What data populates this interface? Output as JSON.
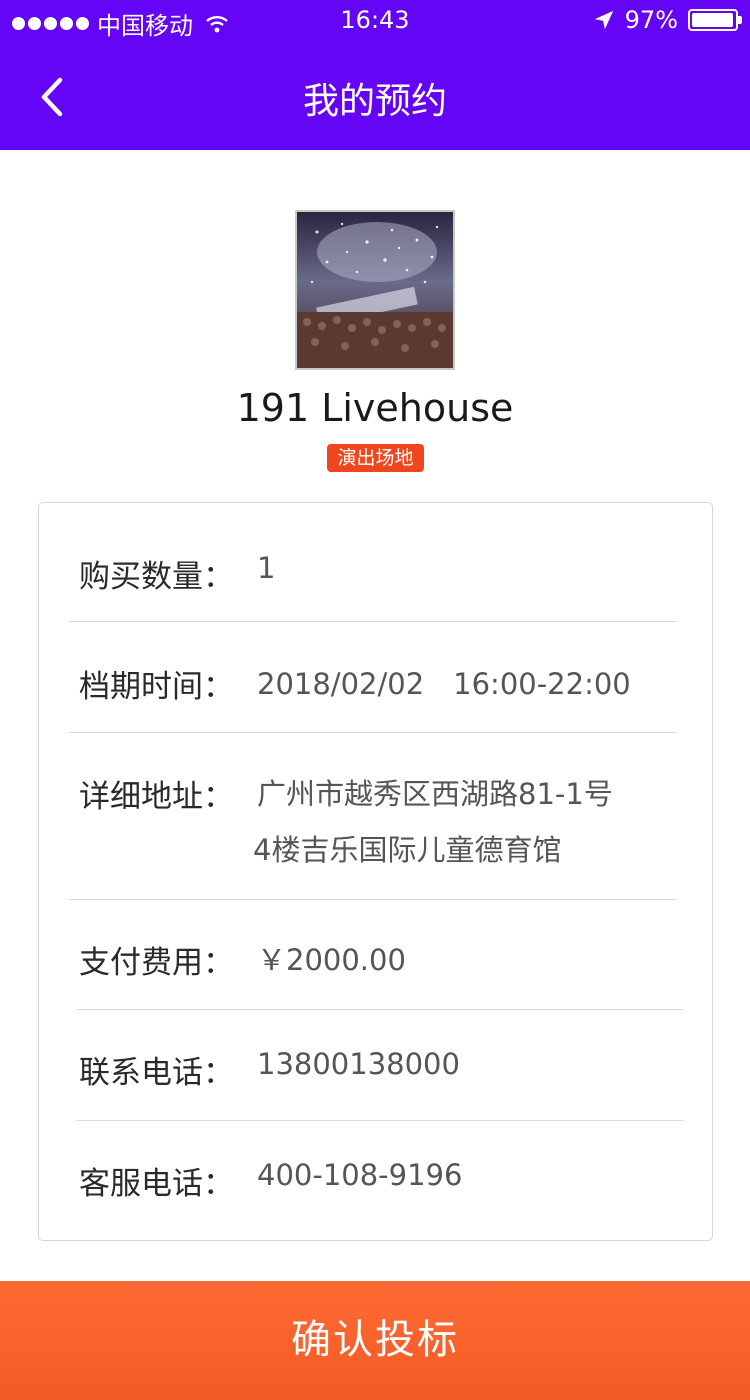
{
  "status_bar": {
    "carrier": "中国移动",
    "time": "16:43",
    "battery": "97%",
    "battery_level": 0.97,
    "icons": [
      "signal-dots-icon",
      "wifi-icon",
      "location-arrow-icon",
      "battery-icon"
    ]
  },
  "header": {
    "title": "我的预约",
    "back_icon": "chevron-left-icon",
    "background": "#6505f5"
  },
  "venue": {
    "name": "191 Livehouse",
    "tag": "演出场地",
    "tag_color": "#f0461e"
  },
  "details": {
    "quantity_label": "购买数量：",
    "quantity_value": "1",
    "schedule_label": "档期时间：",
    "schedule_value": "2018/02/02　16:00-22:00",
    "address_label": "详细地址：",
    "address_line1": "广州市越秀区西湖路81-1号",
    "address_line2": "4楼吉乐国际儿童德育馆",
    "fee_label": "支付费用：",
    "fee_value": "￥2000.00",
    "contact_label": "联系电话：",
    "contact_value": "13800138000",
    "service_label": "客服电话：",
    "service_value": "400-108-9196"
  },
  "action": {
    "confirm_label": "确认投标",
    "color": "#f35a23"
  }
}
